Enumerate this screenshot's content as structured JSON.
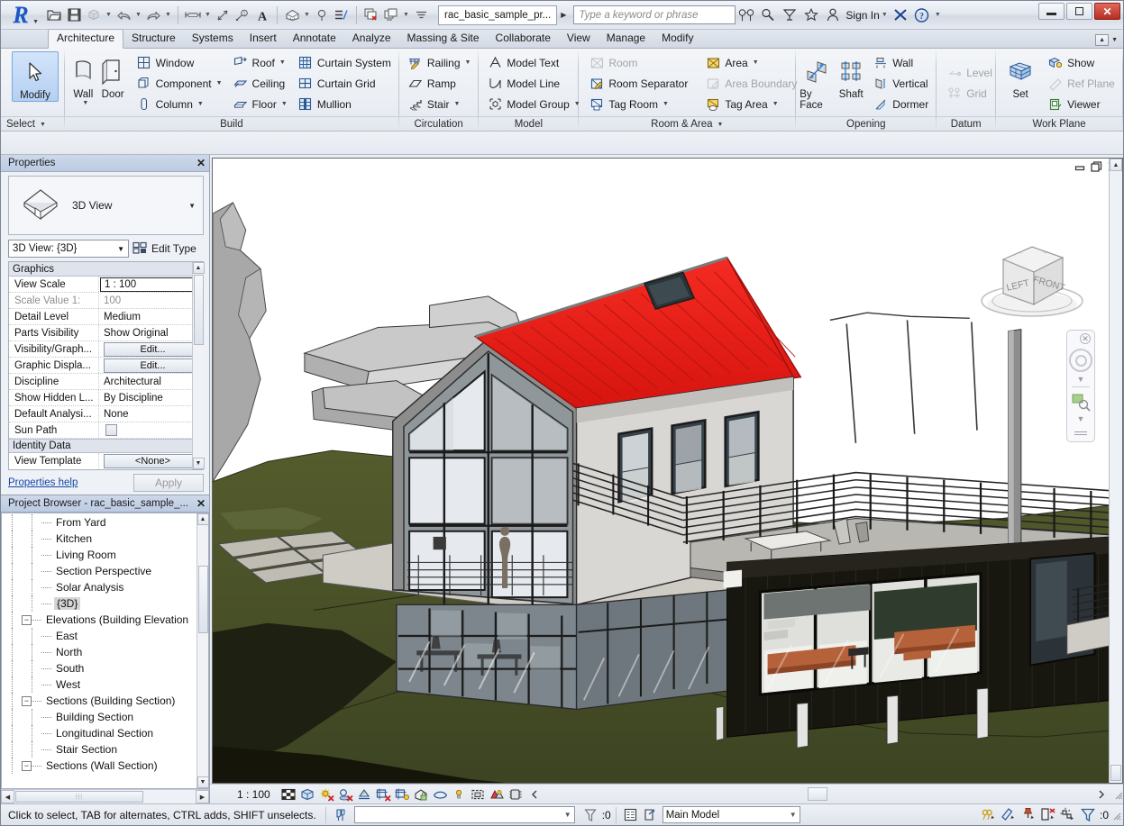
{
  "titlebar": {
    "document_tab": "rac_basic_sample_pr...",
    "search_placeholder": "Type a keyword or phrase",
    "sign_in": "Sign In",
    "qat_items": [
      "open-icon",
      "save-icon",
      "save-as-icon",
      "undo-icon",
      "redo-icon",
      "measure-icon",
      "aligned-dimension-icon",
      "tag-icon",
      "text-icon",
      "default-3d-view-icon",
      "section-icon",
      "thin-lines-icon",
      "close-hidden-windows-icon",
      "switch-windows-icon",
      "customize-qat-icon"
    ],
    "right_icons": [
      "search-icon",
      "help-search-icon",
      "subscription-icon",
      "favorites-icon",
      "account-icon",
      "exchange-icon",
      "question-icon"
    ],
    "window_buttons": [
      "minimize",
      "restore",
      "close"
    ]
  },
  "ribbon": {
    "tabs": [
      "Architecture",
      "Structure",
      "Systems",
      "Insert",
      "Annotate",
      "Analyze",
      "Massing & Site",
      "Collaborate",
      "View",
      "Manage",
      "Modify"
    ],
    "active_tab": "Architecture",
    "panels": [
      {
        "title": "Select",
        "title_align": "left",
        "has_dropdown": true,
        "big_buttons": [
          {
            "label": "Modify",
            "icon": "modify-cursor-icon",
            "selected": true
          }
        ],
        "groups": []
      },
      {
        "title": "Build",
        "has_dropdown": false,
        "big_buttons": [
          {
            "label": "Wall",
            "icon": "wall-icon",
            "has_dropdown": true
          },
          {
            "label": "Door",
            "icon": "door-icon",
            "has_dropdown": false
          }
        ],
        "groups": [
          [
            {
              "label": "Window",
              "icon": "window-icon",
              "dropdown": false,
              "disabled": false
            },
            {
              "label": "Component",
              "icon": "component-icon",
              "dropdown": true,
              "disabled": false
            },
            {
              "label": "Column",
              "icon": "column-icon",
              "dropdown": true,
              "disabled": false
            }
          ],
          [
            {
              "label": "Roof",
              "icon": "roof-icon",
              "dropdown": true,
              "disabled": false
            },
            {
              "label": "Ceiling",
              "icon": "ceiling-icon",
              "dropdown": false,
              "disabled": false
            },
            {
              "label": "Floor",
              "icon": "floor-icon",
              "dropdown": true,
              "disabled": false
            }
          ],
          [
            {
              "label": "Curtain System",
              "icon": "curtain-system-icon",
              "dropdown": false,
              "disabled": false
            },
            {
              "label": "Curtain Grid",
              "icon": "curtain-grid-icon",
              "dropdown": false,
              "disabled": false
            },
            {
              "label": "Mullion",
              "icon": "mullion-icon",
              "dropdown": false,
              "disabled": false
            }
          ]
        ]
      },
      {
        "title": "Circulation",
        "has_dropdown": false,
        "big_buttons": [],
        "groups": [
          [
            {
              "label": "Railing",
              "icon": "railing-icon",
              "dropdown": true,
              "disabled": false
            },
            {
              "label": "Ramp",
              "icon": "ramp-icon",
              "dropdown": false,
              "disabled": false
            },
            {
              "label": "Stair",
              "icon": "stair-icon",
              "dropdown": true,
              "disabled": false
            }
          ]
        ]
      },
      {
        "title": "Model",
        "has_dropdown": false,
        "big_buttons": [],
        "groups": [
          [
            {
              "label": "Model Text",
              "icon": "model-text-icon",
              "dropdown": false,
              "disabled": false
            },
            {
              "label": "Model Line",
              "icon": "model-line-icon",
              "dropdown": false,
              "disabled": false
            },
            {
              "label": "Model Group",
              "icon": "model-group-icon",
              "dropdown": true,
              "disabled": false
            }
          ]
        ]
      },
      {
        "title": "Room & Area",
        "has_dropdown": true,
        "big_buttons": [],
        "groups": [
          [
            {
              "label": "Room",
              "icon": "room-icon",
              "dropdown": false,
              "disabled": true
            },
            {
              "label": "Room Separator",
              "icon": "room-separator-icon",
              "dropdown": false,
              "disabled": false
            },
            {
              "label": "Tag Room",
              "icon": "tag-room-icon",
              "dropdown": true,
              "disabled": false
            }
          ],
          [
            {
              "label": "Area",
              "icon": "area-icon",
              "dropdown": true,
              "disabled": false
            },
            {
              "label": "Area Boundary",
              "icon": "area-boundary-icon",
              "dropdown": false,
              "disabled": true
            },
            {
              "label": "Tag Area",
              "icon": "tag-area-icon",
              "dropdown": true,
              "disabled": false
            }
          ]
        ]
      },
      {
        "title": "Opening",
        "has_dropdown": false,
        "big_buttons": [
          {
            "label": "By Face",
            "icon": "by-face-icon",
            "has_dropdown": false
          },
          {
            "label": "Shaft",
            "icon": "shaft-icon",
            "has_dropdown": false
          }
        ],
        "groups": [
          [
            {
              "label": "Wall",
              "icon": "wall-opening-icon",
              "dropdown": false,
              "disabled": false
            },
            {
              "label": "Vertical",
              "icon": "vertical-opening-icon",
              "dropdown": false,
              "disabled": false
            },
            {
              "label": "Dormer",
              "icon": "dormer-opening-icon",
              "dropdown": false,
              "disabled": false
            }
          ]
        ]
      },
      {
        "title": "Datum",
        "has_dropdown": false,
        "big_buttons": [],
        "groups": [
          [
            {
              "label": "Level",
              "icon": "level-icon",
              "dropdown": false,
              "disabled": true
            },
            {
              "label": "Grid",
              "icon": "grid-icon",
              "dropdown": false,
              "disabled": true
            }
          ]
        ]
      },
      {
        "title": "Work Plane",
        "has_dropdown": false,
        "big_buttons": [
          {
            "label": "Set",
            "icon": "set-workplane-icon",
            "has_dropdown": false
          }
        ],
        "groups": [
          [
            {
              "label": "Show",
              "icon": "show-workplane-icon",
              "dropdown": false,
              "disabled": false
            },
            {
              "label": "Ref Plane",
              "icon": "ref-plane-icon",
              "dropdown": false,
              "disabled": true
            },
            {
              "label": "Viewer",
              "icon": "workplane-viewer-icon",
              "dropdown": false,
              "disabled": false
            }
          ]
        ]
      }
    ]
  },
  "properties": {
    "panel_title": "Properties",
    "type_label": "3D View",
    "type_selector": "3D View: {3D}",
    "edit_type_label": "Edit Type",
    "help_link": "Properties help",
    "apply_label": "Apply",
    "sections": [
      {
        "name": "Graphics",
        "rows": [
          {
            "name": "View Scale",
            "value": "1 : 100",
            "kind": "boxed",
            "dim": false
          },
          {
            "name": "Scale Value    1:",
            "value": "100",
            "kind": "text",
            "dim": true
          },
          {
            "name": "Detail Level",
            "value": "Medium",
            "kind": "text",
            "dim": false
          },
          {
            "name": "Parts Visibility",
            "value": "Show Original",
            "kind": "text",
            "dim": false
          },
          {
            "name": "Visibility/Graph...",
            "value": "Edit...",
            "kind": "button",
            "dim": false
          },
          {
            "name": "Graphic Displa...",
            "value": "Edit...",
            "kind": "button",
            "dim": false
          },
          {
            "name": "Discipline",
            "value": "Architectural",
            "kind": "text",
            "dim": false
          },
          {
            "name": "Show Hidden L...",
            "value": "By Discipline",
            "kind": "text",
            "dim": false
          },
          {
            "name": "Default Analysi...",
            "value": "None",
            "kind": "text",
            "dim": false
          },
          {
            "name": "Sun Path",
            "value": "",
            "kind": "checkbox",
            "dim": false
          }
        ]
      },
      {
        "name": "Identity Data",
        "rows": [
          {
            "name": "View Template",
            "value": "<None>",
            "kind": "button",
            "dim": false
          }
        ]
      }
    ]
  },
  "project_browser": {
    "panel_title": "Project Browser - rac_basic_sample_...",
    "nodes": [
      {
        "label": "From Yard",
        "depth": 2,
        "type": "leaf",
        "selected": false
      },
      {
        "label": "Kitchen",
        "depth": 2,
        "type": "leaf",
        "selected": false
      },
      {
        "label": "Living Room",
        "depth": 2,
        "type": "leaf",
        "selected": false
      },
      {
        "label": "Section Perspective",
        "depth": 2,
        "type": "leaf",
        "selected": false
      },
      {
        "label": "Solar Analysis",
        "depth": 2,
        "type": "leaf",
        "selected": false
      },
      {
        "label": "{3D}",
        "depth": 2,
        "type": "leaf",
        "selected": true
      },
      {
        "label": "Elevations (Building Elevation",
        "depth": 1,
        "type": "branch",
        "selected": false
      },
      {
        "label": "East",
        "depth": 2,
        "type": "leaf",
        "selected": false
      },
      {
        "label": "North",
        "depth": 2,
        "type": "leaf",
        "selected": false
      },
      {
        "label": "South",
        "depth": 2,
        "type": "leaf",
        "selected": false
      },
      {
        "label": "West",
        "depth": 2,
        "type": "leaf",
        "selected": false
      },
      {
        "label": "Sections (Building Section)",
        "depth": 1,
        "type": "branch",
        "selected": false
      },
      {
        "label": "Building Section",
        "depth": 2,
        "type": "leaf",
        "selected": false
      },
      {
        "label": "Longitudinal Section",
        "depth": 2,
        "type": "leaf",
        "selected": false
      },
      {
        "label": "Stair Section",
        "depth": 2,
        "type": "leaf",
        "selected": false
      },
      {
        "label": "Sections (Wall Section)",
        "depth": 1,
        "type": "branch",
        "selected": false
      }
    ]
  },
  "view": {
    "cube_faces": {
      "left": "LEFT",
      "front": "FRONT"
    },
    "window_buttons": [
      "minimize-view-icon",
      "restore-view-icon",
      "close-view-icon"
    ],
    "control_bar": {
      "scale": "1 : 100",
      "icons": [
        "detail-level-icon",
        "visual-style-icon",
        "sun-path-off-icon",
        "shadows-off-icon",
        "rendering-dialog-icon",
        "crop-view-off-icon",
        "show-crop-region-icon",
        "lock-3d-view-icon",
        "temporary-hide-isolate-icon",
        "reveal-hidden-elements-icon",
        "temporary-view-properties-icon",
        "analytical-model-icon",
        "constraints-icon",
        "expand-icon"
      ]
    },
    "colors": {
      "roof": "#ee1c18",
      "sky": "#ffffff",
      "grass": "#4c5429",
      "grass_dark": "#3a4020",
      "wall_light": "#d6d4d2",
      "wall_dark": "#1b1a18",
      "glass": "#8e979c",
      "terrain_rock": "#a6a6a6",
      "sofa": "#b8633a"
    }
  },
  "statusbar": {
    "hint": "Click to select, TAB for alternates, CTRL adds, SHIFT unselects.",
    "filter_count": ":0",
    "workset_combo": "",
    "design_option": "Main Model",
    "selection_count": ":0",
    "right_icons": [
      "exclude-options-icon",
      "editable-only-icon",
      "pinned-icon",
      "faces-icon",
      "links-icon",
      "filter-icon"
    ],
    "left_icons": [
      "model-status-icon"
    ]
  }
}
